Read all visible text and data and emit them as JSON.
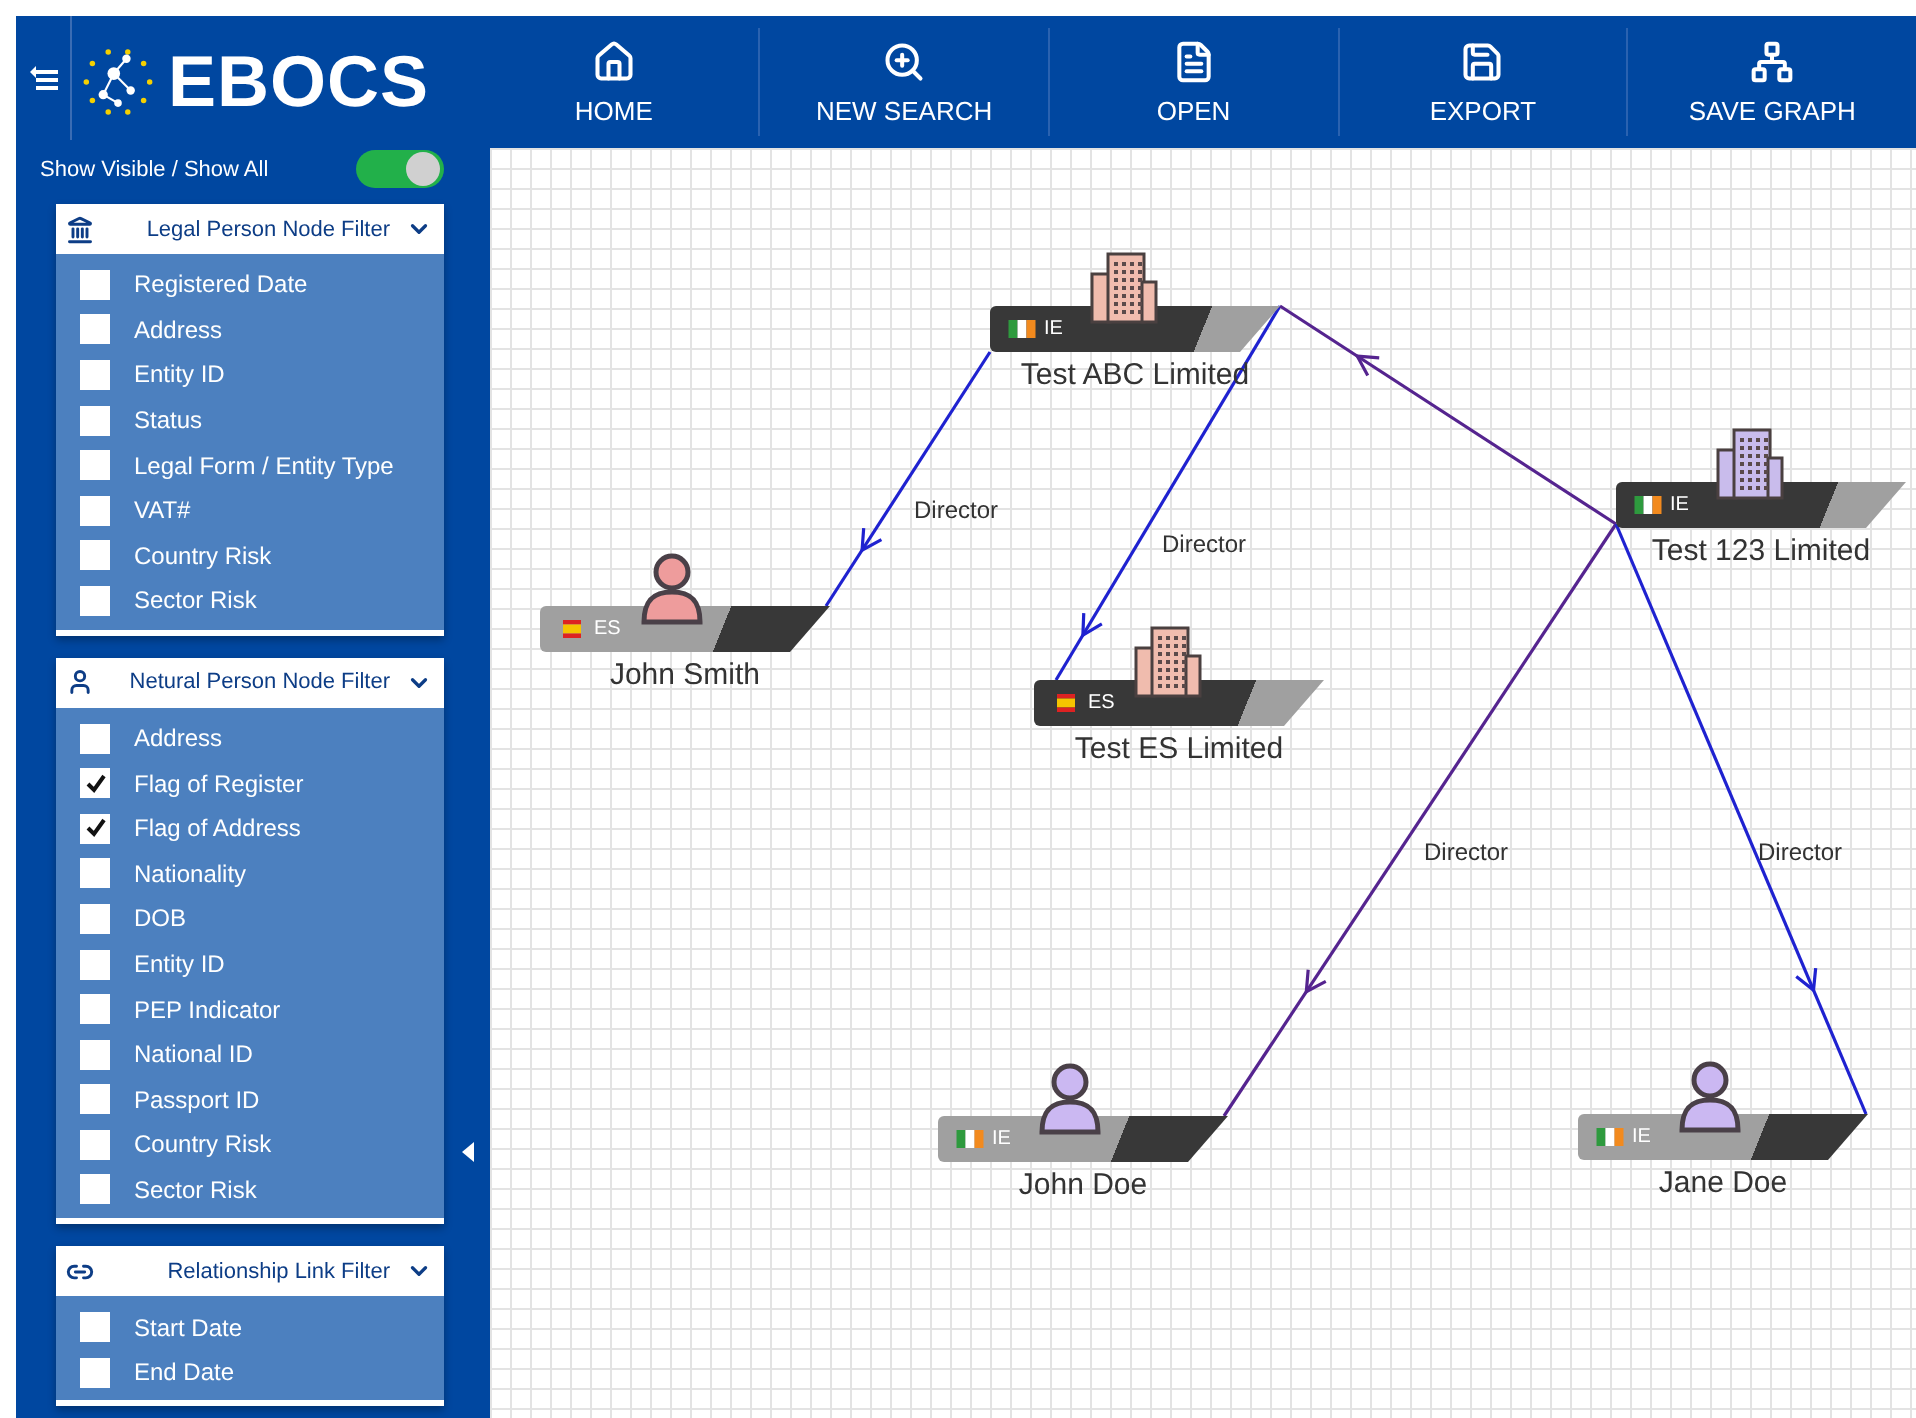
{
  "header": {
    "logo": "EBOCS",
    "nav": [
      {
        "kind": "home",
        "label": "HOME"
      },
      {
        "kind": "search",
        "label": "NEW SEARCH"
      },
      {
        "kind": "open",
        "label": "OPEN"
      },
      {
        "kind": "export",
        "label": "EXPORT"
      },
      {
        "kind": "graph",
        "label": "SAVE GRAPH"
      }
    ]
  },
  "sidebar": {
    "toggle": {
      "label": "Show Visible / Show All",
      "on": true
    },
    "filters": [
      {
        "kind": "legal",
        "title": "Legal Person Node Filter",
        "expanded": true,
        "items": [
          {
            "label": "Registered Date",
            "checked": false
          },
          {
            "label": "Address",
            "checked": false
          },
          {
            "label": "Entity ID",
            "checked": false
          },
          {
            "label": "Status",
            "checked": false
          },
          {
            "label": "Legal Form / Entity Type",
            "checked": false
          },
          {
            "label": "VAT#",
            "checked": false
          },
          {
            "label": "Country Risk",
            "checked": false
          },
          {
            "label": "Sector Risk",
            "checked": false
          }
        ]
      },
      {
        "kind": "natural",
        "title": "Netural Person Node Filter",
        "expanded": true,
        "items": [
          {
            "label": "Address",
            "checked": false
          },
          {
            "label": "Flag of Register",
            "checked": true
          },
          {
            "label": "Flag of Address",
            "checked": true
          },
          {
            "label": "Nationality",
            "checked": false
          },
          {
            "label": "DOB",
            "checked": false
          },
          {
            "label": "Entity ID",
            "checked": false
          },
          {
            "label": "PEP Indicator",
            "checked": false
          },
          {
            "label": "National ID",
            "checked": false
          },
          {
            "label": "Passport ID",
            "checked": false
          },
          {
            "label": "Country Risk",
            "checked": false
          },
          {
            "label": "Sector Risk",
            "checked": false
          }
        ]
      },
      {
        "kind": "link",
        "title": "Relationship Link Filter",
        "expanded": true,
        "items": [
          {
            "label": "Start Date",
            "checked": false
          },
          {
            "label": "End Date",
            "checked": false
          }
        ]
      }
    ]
  },
  "graph": {
    "nodes": [
      {
        "kind": "legal",
        "name": "Test ABC Limited",
        "country": "IE",
        "flag": {
          "kind": "ireland"
        },
        "color": "#f0bcae"
      },
      {
        "kind": "legal",
        "name": "Test 123 Limited",
        "country": "IE",
        "flag": {
          "kind": "ireland"
        },
        "color": "#c9bcec"
      },
      {
        "kind": "natural",
        "name": "John Smith",
        "country": "ES",
        "flag": {
          "kind": "spain"
        },
        "color": "#ee9c9c"
      },
      {
        "kind": "legal",
        "name": "Test ES Limited",
        "country": "ES",
        "flag": {
          "kind": "spain"
        },
        "color": "#f0bcae"
      },
      {
        "kind": "natural",
        "name": "John Doe",
        "country": "IE",
        "flag": {
          "kind": "ireland"
        },
        "color": "#cbb8f2"
      },
      {
        "kind": "natural",
        "name": "Jane Doe",
        "country": "IE",
        "flag": {
          "kind": "ireland"
        },
        "color": "#cbb8f2"
      }
    ],
    "edges": [
      {
        "label": "Director",
        "color": "#1f22d0"
      },
      {
        "label": "Director",
        "color": "#1f22d0"
      },
      {
        "color": "#55248f"
      },
      {
        "label": "Director",
        "color": "#55248f"
      },
      {
        "label": "Director",
        "color": "#1f22d0"
      }
    ]
  }
}
